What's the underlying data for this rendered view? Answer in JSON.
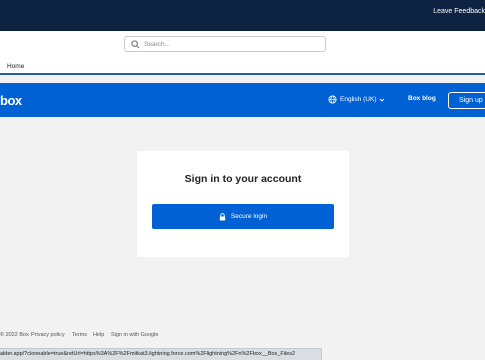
{
  "topbar": {
    "feedback_label": "Leave Feedback"
  },
  "search": {
    "placeholder": "Search..."
  },
  "nav": {
    "home_label": "Home"
  },
  "box_header": {
    "logo_text": "box",
    "language_label": "English (UK)",
    "blog_label": "Box blog",
    "signup_label": "Sign up"
  },
  "login_card": {
    "title": "Sign in to your account",
    "secure_login_label": "Secure login"
  },
  "footer": {
    "copyright": "© 2022 Box",
    "privacy": "Privacy policy",
    "terms": "Terms",
    "help": "Help",
    "google_signin": "Sign in with Google"
  },
  "status_bar": {
    "url": "alder.app/?cloneable=true&retUrl=https%3A%2F%2Fmitkat3.lightning.force.com%2Flightning%2Fn%2Fbox__Box_Files2"
  },
  "colors": {
    "topbar_bg": "#0e2341",
    "box_blue": "#0061d5",
    "page_bg": "#f2f2f2"
  }
}
